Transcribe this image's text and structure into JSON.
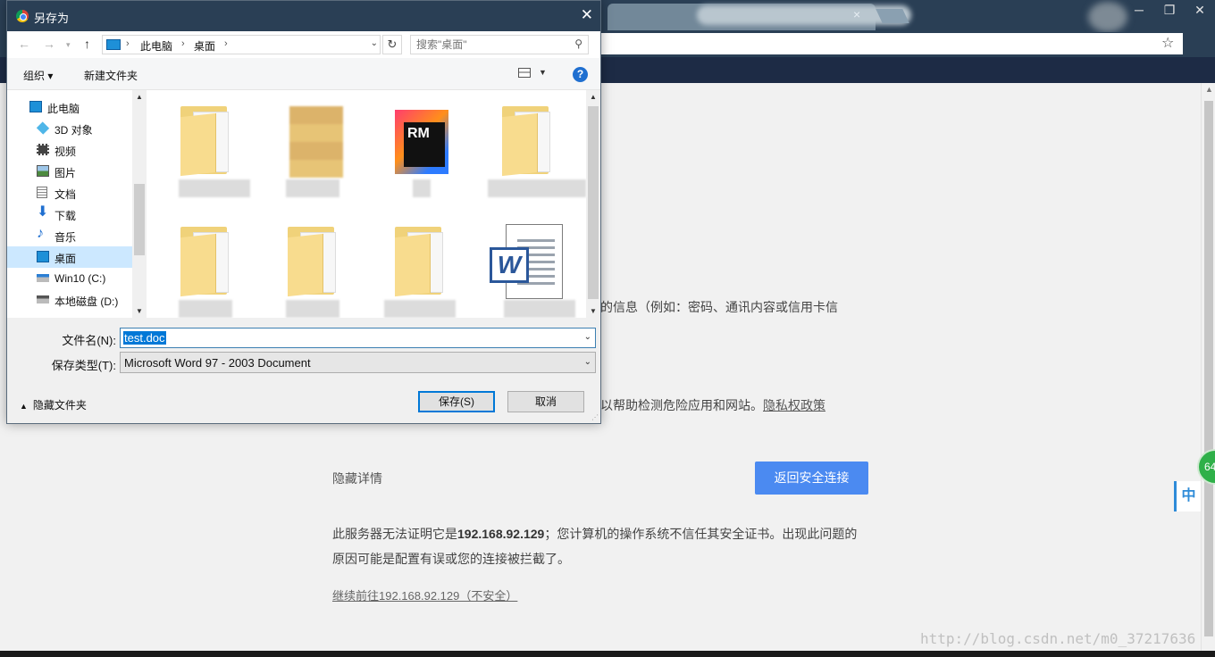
{
  "browser": {
    "tab_close": "×",
    "win_min": "─",
    "win_max": "❐",
    "win_close": "✕",
    "star": "☆"
  },
  "page": {
    "line_info": "的信息（例如：密码、通讯内容或信用卡信",
    "line_help": "以帮助检测危险应用和网站。",
    "privacy_link": "隐私权政策",
    "hide_details": "隐藏详情",
    "back_button": "返回安全连接",
    "cert_text_pre": "此服务器无法证明它是",
    "cert_ip": "192.168.92.129",
    "cert_text_post": "；您计算机的操作系统不信任其安全证书。出现此问题的原因可能是配置有误或您的连接被拦截了。",
    "proceed_link": "继续前往192.168.92.129（不安全）",
    "ime": "中",
    "ext_badge": "64",
    "watermark": "http://blog.csdn.net/m0_37217636"
  },
  "dialog": {
    "title": "另存为",
    "close": "✕",
    "breadcrumb": [
      "此电脑",
      "桌面"
    ],
    "search_placeholder": "搜索\"桌面\"",
    "toolbar": {
      "organize": "组织 ▾",
      "new_folder": "新建文件夹",
      "help": "?"
    },
    "nav_items": [
      {
        "label": "此电脑",
        "icon": "computer-icon"
      },
      {
        "label": "3D 对象",
        "icon": "cube-icon"
      },
      {
        "label": "视频",
        "icon": "video-icon"
      },
      {
        "label": "图片",
        "icon": "picture-icon"
      },
      {
        "label": "文档",
        "icon": "document-icon"
      },
      {
        "label": "下载",
        "icon": "download-icon"
      },
      {
        "label": "音乐",
        "icon": "music-icon"
      },
      {
        "label": "桌面",
        "icon": "desktop-icon",
        "selected": true
      },
      {
        "label": "Win10 (C:)",
        "icon": "drive-icon"
      },
      {
        "label": "本地磁盘 (D:)",
        "icon": "drive-icon"
      }
    ],
    "filename_label": "文件名(N):",
    "filename_value": "test.doc",
    "filetype_label": "保存类型(T):",
    "filetype_value": "Microsoft Word 97 - 2003 Document",
    "hide_folders": "隐藏文件夹",
    "save_button": "保存(S)",
    "cancel_button": "取消"
  }
}
